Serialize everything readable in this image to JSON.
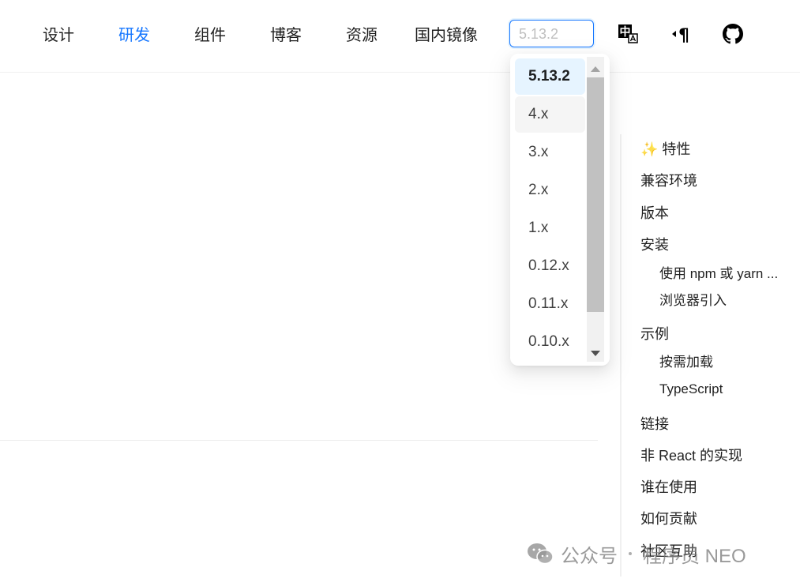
{
  "nav": {
    "items": [
      {
        "label": "设计"
      },
      {
        "label": "研发"
      },
      {
        "label": "组件"
      },
      {
        "label": "博客"
      },
      {
        "label": "资源"
      },
      {
        "label": "国内镜像"
      }
    ],
    "active_index": 1
  },
  "version_select": {
    "value": "5.13.2",
    "options": [
      {
        "label": "5.13.2"
      },
      {
        "label": "4.x"
      },
      {
        "label": "3.x"
      },
      {
        "label": "2.x"
      },
      {
        "label": "1.x"
      },
      {
        "label": "0.12.x"
      },
      {
        "label": "0.11.x"
      },
      {
        "label": "0.10.x"
      }
    ]
  },
  "header_icons": {
    "lang_glyph": "中",
    "direction_glyph": "¶"
  },
  "toc": {
    "items": [
      {
        "label": "✨ 特性"
      },
      {
        "label": "兼容环境"
      },
      {
        "label": "版本"
      },
      {
        "label": "安装"
      },
      {
        "label": "使用 npm 或 yarn ..."
      },
      {
        "label": "浏览器引入"
      },
      {
        "label": "示例"
      },
      {
        "label": "按需加载"
      },
      {
        "label": "TypeScript"
      },
      {
        "label": "链接"
      },
      {
        "label": "非 React 的实现"
      },
      {
        "label": "谁在使用"
      },
      {
        "label": "如何贡献"
      },
      {
        "label": "社区互助"
      }
    ]
  },
  "watermark": {
    "account_type": "公众号",
    "account_name": "程序员 NEO"
  },
  "colors": {
    "primary": "#1677ff",
    "selected_bg": "#e6f4ff"
  }
}
